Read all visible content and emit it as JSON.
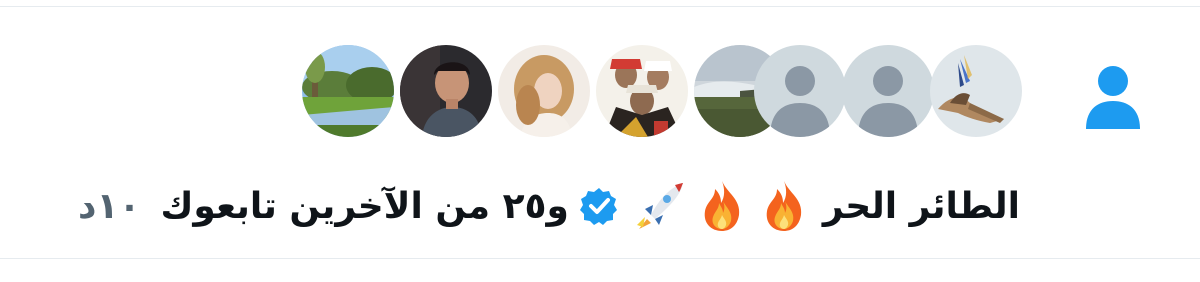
{
  "notification": {
    "type_icon": "person-icon",
    "accent_color": "#1d9bf0",
    "avatars": [
      {
        "name": "avatar-landscape-river",
        "icon": "landscape-photo"
      },
      {
        "name": "avatar-man-car",
        "icon": "portrait-photo"
      },
      {
        "name": "avatar-woman-blonde",
        "icon": "portrait-photo"
      },
      {
        "name": "avatar-kings-portrait",
        "icon": "portrait-photo"
      },
      {
        "name": "avatar-foggy-field",
        "icon": "landscape-photo"
      },
      {
        "name": "avatar-default-1",
        "icon": "default-avatar-icon"
      },
      {
        "name": "avatar-default-2",
        "icon": "default-avatar-icon"
      },
      {
        "name": "avatar-falcon",
        "icon": "bird-photo"
      }
    ],
    "user_display_name": "الطائر الحر",
    "name_emojis": [
      "fire-emoji",
      "fire-emoji",
      "rocket-emoji"
    ],
    "verified_badge": "verified-badge-icon",
    "others_text": "و٢٥ من الآخرين تابعوك",
    "timestamp": "١٠د"
  }
}
